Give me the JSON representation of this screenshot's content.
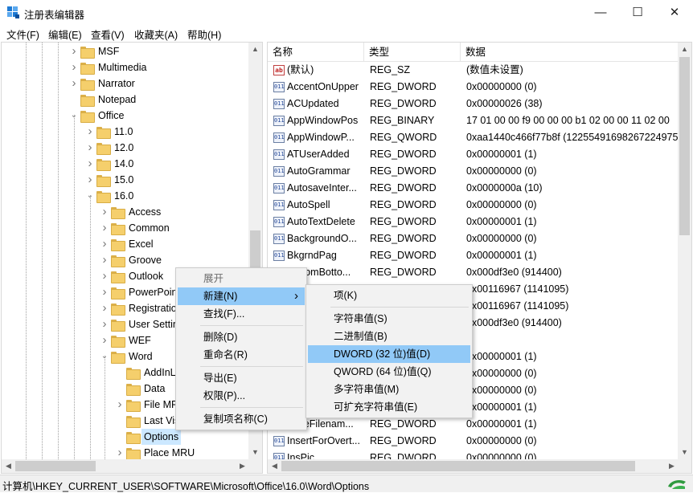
{
  "window": {
    "title": "注册表编辑器",
    "minimize_glyph": "—",
    "maximize_glyph": "☐",
    "close_glyph": "✕"
  },
  "menu": [
    "文件(F)",
    "编辑(E)",
    "查看(V)",
    "收藏夹(A)",
    "帮助(H)"
  ],
  "tree": {
    "items": [
      {
        "label": "MSF",
        "level": 0,
        "chevron": "right"
      },
      {
        "label": "Multimedia",
        "level": 0,
        "chevron": "right"
      },
      {
        "label": "Narrator",
        "level": 0,
        "chevron": "right"
      },
      {
        "label": "Notepad",
        "level": 0,
        "chevron": "none"
      },
      {
        "label": "Office",
        "level": 0,
        "chevron": "down"
      },
      {
        "label": "11.0",
        "level": 1,
        "chevron": "right"
      },
      {
        "label": "12.0",
        "level": 1,
        "chevron": "right"
      },
      {
        "label": "14.0",
        "level": 1,
        "chevron": "right"
      },
      {
        "label": "15.0",
        "level": 1,
        "chevron": "right"
      },
      {
        "label": "16.0",
        "level": 1,
        "chevron": "down"
      },
      {
        "label": "Access",
        "level": 2,
        "chevron": "right"
      },
      {
        "label": "Common",
        "level": 2,
        "chevron": "right"
      },
      {
        "label": "Excel",
        "level": 2,
        "chevron": "right"
      },
      {
        "label": "Groove",
        "level": 2,
        "chevron": "right"
      },
      {
        "label": "Outlook",
        "level": 2,
        "chevron": "right"
      },
      {
        "label": "PowerPoint",
        "level": 2,
        "chevron": "right"
      },
      {
        "label": "Registration",
        "level": 2,
        "chevron": "right"
      },
      {
        "label": "User Settings",
        "level": 2,
        "chevron": "right"
      },
      {
        "label": "WEF",
        "level": 2,
        "chevron": "right"
      },
      {
        "label": "Word",
        "level": 2,
        "chevron": "down"
      },
      {
        "label": "AddInLoadTimes",
        "level": 3,
        "chevron": "none"
      },
      {
        "label": "Data",
        "level": 3,
        "chevron": "none"
      },
      {
        "label": "File MRU",
        "level": 3,
        "chevron": "right"
      },
      {
        "label": "Last Visited",
        "level": 3,
        "chevron": "none"
      },
      {
        "label": "Options",
        "level": 3,
        "chevron": "none",
        "selected": true
      },
      {
        "label": "Place MRU",
        "level": 3,
        "chevron": "right"
      }
    ]
  },
  "list": {
    "columns": [
      "名称",
      "类型",
      "数据"
    ],
    "rows": [
      {
        "icon": "string-value-icon",
        "name": "(默认)",
        "type": "REG_SZ",
        "data": "(数值未设置)"
      },
      {
        "icon": "binary-value-icon",
        "name": "AccentOnUpper",
        "type": "REG_DWORD",
        "data": "0x00000000 (0)"
      },
      {
        "icon": "binary-value-icon",
        "name": "ACUpdated",
        "type": "REG_DWORD",
        "data": "0x00000026 (38)"
      },
      {
        "icon": "binary-value-icon",
        "name": "AppWindowPos",
        "type": "REG_BINARY",
        "data": "17 01 00 00 f9 00 00 00 b1 02 00 00 11 02 00"
      },
      {
        "icon": "binary-value-icon",
        "name": "AppWindowP...",
        "type": "REG_QWORD",
        "data": "0xaa1440c466f77b8f (12255491698267224975)"
      },
      {
        "icon": "binary-value-icon",
        "name": "ATUserAdded",
        "type": "REG_DWORD",
        "data": "0x00000001 (1)"
      },
      {
        "icon": "binary-value-icon",
        "name": "AutoGrammar",
        "type": "REG_DWORD",
        "data": "0x00000000 (0)"
      },
      {
        "icon": "binary-value-icon",
        "name": "AutosaveInter...",
        "type": "REG_DWORD",
        "data": "0x0000000a (10)"
      },
      {
        "icon": "binary-value-icon",
        "name": "AutoSpell",
        "type": "REG_DWORD",
        "data": "0x00000000 (0)"
      },
      {
        "icon": "binary-value-icon",
        "name": "AutoTextDelete",
        "type": "REG_DWORD",
        "data": "0x00000001 (1)"
      },
      {
        "icon": "binary-value-icon",
        "name": "BackgroundO...",
        "type": "REG_DWORD",
        "data": "0x00000000 (0)"
      },
      {
        "icon": "binary-value-icon",
        "name": "BkgrndPag",
        "type": "REG_DWORD",
        "data": "0x00000001 (1)"
      },
      {
        "icon": "binary-value-icon",
        "name": "BottomBotto...",
        "type": "REG_DWORD",
        "data": "0x000df3e0 (914400)"
      },
      {
        "icon": "binary-value-icon",
        "name": "",
        "type": "",
        "data": "0x00116967 (1141095)"
      },
      {
        "icon": "binary-value-icon",
        "name": "",
        "type": "",
        "data": "0x00116967 (1141095)"
      },
      {
        "icon": "binary-value-icon",
        "name": "",
        "type": "",
        "data": "0x000df3e0 (914400)"
      },
      {
        "icon": "binary-value-icon",
        "name": "",
        "type": "",
        "data": ""
      },
      {
        "icon": "binary-value-icon",
        "name": "",
        "type": "",
        "data": "0x00000001 (1)"
      },
      {
        "icon": "binary-value-icon",
        "name": "",
        "type": "",
        "data": "0x00000000 (0)"
      },
      {
        "icon": "binary-value-icon",
        "name": "",
        "type": "",
        "data": "0x00000000 (0)"
      },
      {
        "icon": "binary-value-icon",
        "name": "",
        "type": "",
        "data": "0x00000001 (1)"
      },
      {
        "icon": "binary-value-icon",
        "name": "IncreFilenam...",
        "type": "REG_DWORD",
        "data": "0x00000001 (1)"
      },
      {
        "icon": "binary-value-icon",
        "name": "InsertForOvert...",
        "type": "REG_DWORD",
        "data": "0x00000000 (0)"
      },
      {
        "icon": "binary-value-icon",
        "name": "InsPic",
        "type": "REG_DWORD",
        "data": "0x00000000 (0)"
      }
    ]
  },
  "context_menu": {
    "items": [
      {
        "label": "展开",
        "disabled": true
      },
      {
        "label": "新建(N)",
        "highlighted": true,
        "submenu": true
      },
      {
        "label": "查找(F)..."
      },
      {
        "sep": true
      },
      {
        "label": "删除(D)"
      },
      {
        "label": "重命名(R)"
      },
      {
        "sep": true
      },
      {
        "label": "导出(E)"
      },
      {
        "label": "权限(P)..."
      },
      {
        "sep": true
      },
      {
        "label": "复制项名称(C)"
      }
    ]
  },
  "submenu": {
    "items": [
      {
        "label": "项(K)"
      },
      {
        "sep": true
      },
      {
        "label": "字符串值(S)"
      },
      {
        "label": "二进制值(B)"
      },
      {
        "label": "DWORD (32 位)值(D)",
        "highlighted": true
      },
      {
        "label": "QWORD (64 位)值(Q)"
      },
      {
        "label": "多字符串值(M)"
      },
      {
        "label": "可扩充字符串值(E)"
      }
    ]
  },
  "status": {
    "path": "计算机\\HKEY_CURRENT_USER\\SOFTWARE\\Microsoft\\Office\\16.0\\Word\\Options"
  },
  "colors": {
    "highlight": "#91c9f7",
    "selection": "#cce8ff",
    "folder": "#f5cf6c"
  }
}
